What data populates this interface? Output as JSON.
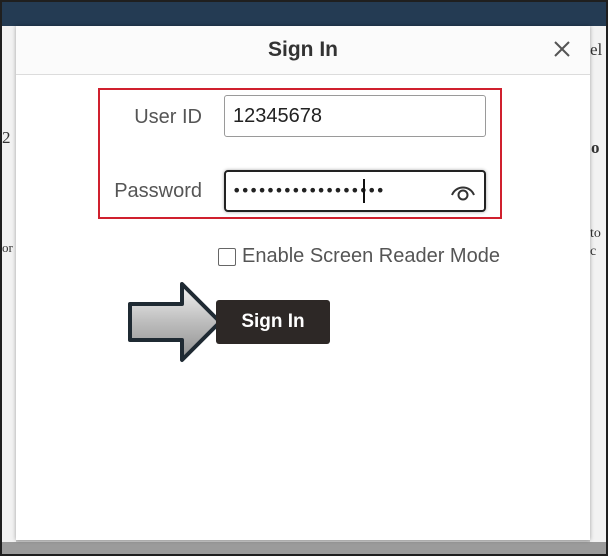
{
  "dialog": {
    "title": "Sign In",
    "close_icon": "close-icon"
  },
  "form": {
    "user_id": {
      "label": "User ID",
      "value": "12345678"
    },
    "password": {
      "label": "Password",
      "masked_value": "••••••••••••••••••",
      "toggle_icon": "eye-icon"
    },
    "screen_reader": {
      "label": "Enable Screen Reader Mode",
      "checked": false
    },
    "submit_label": "Sign In"
  },
  "annotation": {
    "highlight_color": "#d0202e",
    "arrow_icon": "arrow-right-icon"
  },
  "background": {
    "fragments": [
      "2",
      "or",
      "el",
      "o",
      "to",
      "c"
    ]
  }
}
